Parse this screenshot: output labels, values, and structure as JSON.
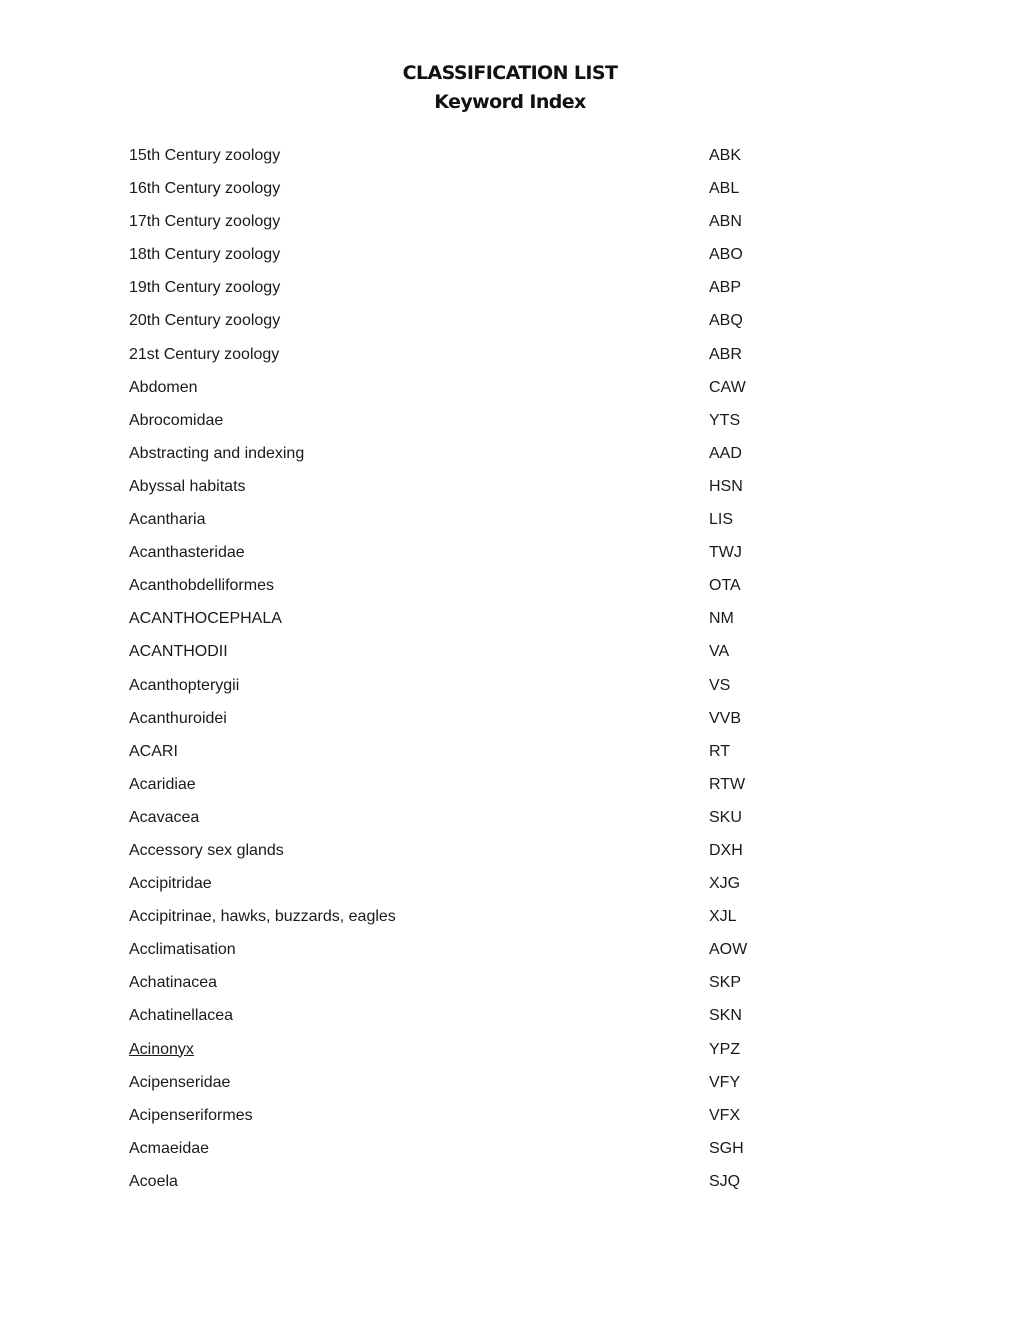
{
  "header": {
    "title": "CLASSIFICATION LIST",
    "subtitle": "Keyword Index"
  },
  "entries": [
    {
      "keyword": "15th Century zoology",
      "code": "ABK",
      "link": false
    },
    {
      "keyword": "16th Century zoology",
      "code": "ABL",
      "link": false
    },
    {
      "keyword": "17th Century zoology",
      "code": "ABN",
      "link": false
    },
    {
      "keyword": "18th Century zoology",
      "code": "ABO",
      "link": false
    },
    {
      "keyword": "19th Century zoology",
      "code": "ABP",
      "link": false
    },
    {
      "keyword": "20th Century zoology",
      "code": "ABQ",
      "link": false
    },
    {
      "keyword": "21st Century zoology",
      "code": "ABR",
      "link": false
    },
    {
      "keyword": "Abdomen",
      "code": "CAW",
      "link": false
    },
    {
      "keyword": "Abrocomidae",
      "code": "YTS",
      "link": false
    },
    {
      "keyword": "Abstracting and indexing",
      "code": "AAD",
      "link": false
    },
    {
      "keyword": "Abyssal habitats",
      "code": "HSN",
      "link": false
    },
    {
      "keyword": "Acantharia",
      "code": "LIS",
      "link": false
    },
    {
      "keyword": "Acanthasteridae",
      "code": "TWJ",
      "link": false
    },
    {
      "keyword": "Acanthobdelliformes",
      "code": "OTA",
      "link": false
    },
    {
      "keyword": "ACANTHOCEPHALA",
      "code": "NM",
      "link": false
    },
    {
      "keyword": "ACANTHODII",
      "code": "VA",
      "link": false
    },
    {
      "keyword": "Acanthopterygii",
      "code": "VS",
      "link": false
    },
    {
      "keyword": "Acanthuroidei",
      "code": "VVB",
      "link": false
    },
    {
      "keyword": "ACARI",
      "code": "RT",
      "link": false
    },
    {
      "keyword": "Acaridiae",
      "code": "RTW",
      "link": false
    },
    {
      "keyword": "Acavacea",
      "code": "SKU",
      "link": false
    },
    {
      "keyword": "Accessory sex glands",
      "code": "DXH",
      "link": false
    },
    {
      "keyword": "Accipitridae",
      "code": "XJG",
      "link": false
    },
    {
      "keyword": "Accipitrinae, hawks, buzzards, eagles",
      "code": "XJL",
      "link": false
    },
    {
      "keyword": "Acclimatisation",
      "code": "AOW",
      "link": false
    },
    {
      "keyword": "Achatinacea",
      "code": "SKP",
      "link": false
    },
    {
      "keyword": "Achatinellacea",
      "code": "SKN",
      "link": false
    },
    {
      "keyword": "Acinonyx",
      "code": "YPZ",
      "link": true
    },
    {
      "keyword": "Acipenseridae",
      "code": "VFY",
      "link": false
    },
    {
      "keyword": "Acipenseriformes",
      "code": "VFX",
      "link": false
    },
    {
      "keyword": "Acmaeidae",
      "code": "SGH",
      "link": false
    },
    {
      "keyword": "Acoela",
      "code": "SJQ",
      "link": false
    }
  ]
}
